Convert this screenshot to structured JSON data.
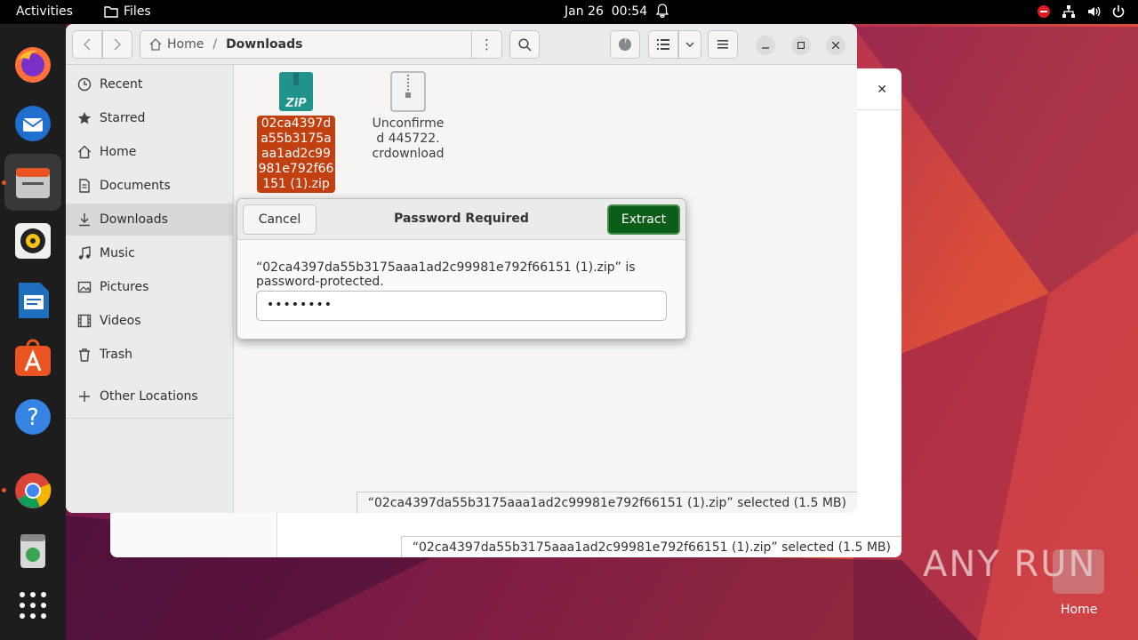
{
  "topbar": {
    "activities": "Activities",
    "app_name": "Files",
    "date": "Jan 26",
    "time": "00:54"
  },
  "dock": {
    "apps": [
      "firefox-icon",
      "thunderbird-icon",
      "files-icon",
      "rhythmbox-icon",
      "writer-icon",
      "app-center-icon",
      "help-icon",
      "chrome-icon",
      "trash-icon",
      "apps-grid-icon"
    ]
  },
  "files_window": {
    "path_home": "Home",
    "path_current": "Downloads",
    "sidebar": [
      {
        "label": "Recent",
        "icon": "clock-icon"
      },
      {
        "label": "Starred",
        "icon": "star-icon"
      },
      {
        "label": "Home",
        "icon": "home-icon"
      },
      {
        "label": "Documents",
        "icon": "document-icon"
      },
      {
        "label": "Downloads",
        "icon": "download-icon"
      },
      {
        "label": "Music",
        "icon": "music-icon"
      },
      {
        "label": "Pictures",
        "icon": "picture-icon"
      },
      {
        "label": "Videos",
        "icon": "video-icon"
      },
      {
        "label": "Trash",
        "icon": "trash-icon"
      },
      {
        "label": "Other Locations",
        "icon": "plus-icon"
      }
    ],
    "files": [
      {
        "name": "02ca4397da55b3175aaa1ad2c99981e792f66151 (1).zip",
        "lines": [
          "02ca4397d",
          "a55b3175a",
          "aa1ad2c99",
          "981e792f66",
          "151 (1).zip"
        ],
        "badge": "ZiP"
      },
      {
        "name": "Unconfirmed 445722.crdownload",
        "lines": [
          "Unconfirme",
          "d 445722.",
          "crdownload"
        ]
      }
    ],
    "status": "“02ca4397da55b3175aaa1ad2c99981e792f66151 (1).zip” selected  (1.5 MB)"
  },
  "back_window": {
    "status": "“02ca4397da55b3175aaa1ad2c99981e792f66151 (1).zip” selected  (1.5 MB)"
  },
  "dialog": {
    "title": "Password Required",
    "cancel": "Cancel",
    "extract": "Extract",
    "message": "“02ca4397da55b3175aaa1ad2c99981e792f66151 (1).zip” is password-protected.",
    "password_masked": "••••••••"
  },
  "desktop": {
    "watermark": "ANY RUN",
    "home_label": "Home"
  },
  "colors": {
    "accent": "#e95420",
    "selection": "#c2400f",
    "extract_button": "#0c5d17"
  }
}
